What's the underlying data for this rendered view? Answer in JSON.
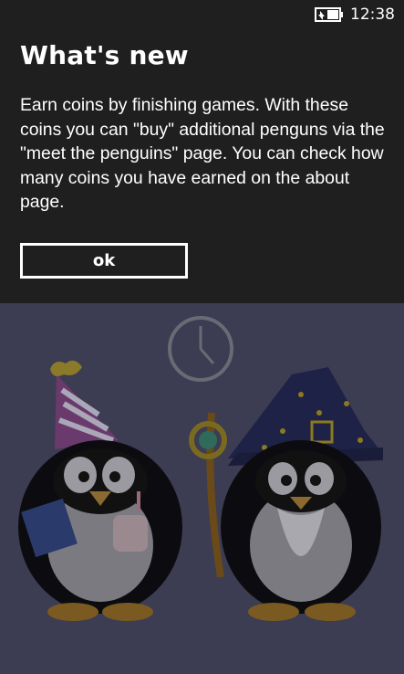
{
  "status_bar": {
    "time": "12:38",
    "battery_icon": "battery-charging-icon"
  },
  "dialog": {
    "title": "What's new",
    "body": "Earn coins by finishing games. With these coins you can \"buy\" additional penguns via the \"meet the penguins\" page. You can check how many coins you have earned on the about page.",
    "ok_label": "ok"
  },
  "background": {
    "timer_icon": "clock-icon",
    "characters": [
      "party-penguin-icon",
      "wizard-penguin-icon"
    ]
  },
  "colors": {
    "status_bar_bg": "#1f1f1f",
    "dialog_bg": "#1f1f1f",
    "scene_bg": "#3c3c52",
    "text": "#ffffff"
  }
}
